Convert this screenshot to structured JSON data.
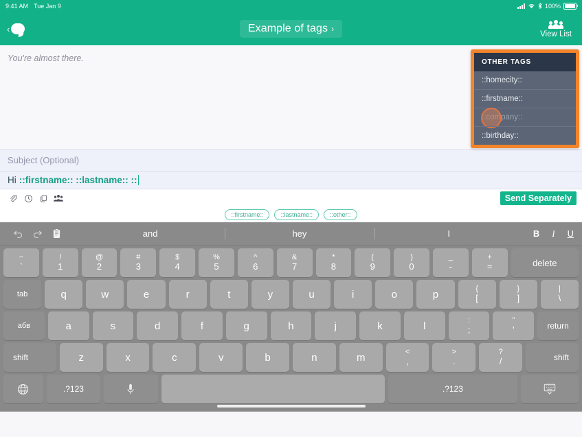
{
  "status_bar": {
    "time": "9:41 AM",
    "date": "Tue Jan 9",
    "battery": "100%",
    "signal_icon": "cellular-signal-icon",
    "wifi_icon": "wifi-icon",
    "battery_icon": "battery-icon"
  },
  "navbar": {
    "back_icon": "back-chevron-icon",
    "messages_icon": "message-bubble-icon",
    "title": "Example of tags",
    "title_chevron": "›",
    "view_list_label": "View List",
    "view_list_icon": "people-group-icon",
    "bg_color": "#12b188"
  },
  "thread": {
    "note": "You're almost there."
  },
  "other_tags_panel": {
    "header": "OTHER TAGS",
    "highlight_color": "#f4842a",
    "items": [
      {
        "label": "::homecity::",
        "dimmed": false,
        "tapped": false
      },
      {
        "label": "::firstname::",
        "dimmed": false,
        "tapped": false
      },
      {
        "label": "::company::",
        "dimmed": true,
        "tapped": true
      },
      {
        "label": "::birthday::",
        "dimmed": false,
        "tapped": false
      }
    ]
  },
  "compose": {
    "subject_placeholder": "Subject (Optional)",
    "message_prefix": "Hi",
    "message_tags": "::firstname:: ::lastname:: ::",
    "icons": [
      {
        "name": "attachment-icon"
      },
      {
        "name": "schedule-clock-icon"
      },
      {
        "name": "templates-icon"
      },
      {
        "name": "group-contacts-icon"
      }
    ],
    "send_separately_label": "Send Separately",
    "send_color": "#13b58c",
    "chips": [
      "::firstname::",
      "::lastname::",
      "::other::"
    ]
  },
  "keyboard": {
    "toolbar": {
      "undo_icon": "undo-icon",
      "redo_icon": "redo-icon",
      "paste_icon": "paste-clipboard-icon",
      "suggestions": [
        "and",
        "hey",
        "I"
      ],
      "bold_label": "B",
      "italic_label": "I",
      "underline_label": "U"
    },
    "row_numbers": [
      {
        "up": "~",
        "lo": "`"
      },
      {
        "up": "!",
        "lo": "1"
      },
      {
        "up": "@",
        "lo": "2"
      },
      {
        "up": "#",
        "lo": "3"
      },
      {
        "up": "$",
        "lo": "4"
      },
      {
        "up": "%",
        "lo": "5"
      },
      {
        "up": "^",
        "lo": "6"
      },
      {
        "up": "&",
        "lo": "7"
      },
      {
        "up": "*",
        "lo": "8"
      },
      {
        "up": "(",
        "lo": "9"
      },
      {
        "up": ")",
        "lo": "0"
      },
      {
        "up": "_",
        "lo": "-"
      },
      {
        "up": "+",
        "lo": "="
      }
    ],
    "delete_label": "delete",
    "tab_label": "tab",
    "row_top": [
      "q",
      "w",
      "e",
      "r",
      "t",
      "y",
      "u",
      "i",
      "o",
      "p"
    ],
    "row_top_extra": [
      {
        "up": "{",
        "lo": "["
      },
      {
        "up": "}",
        "lo": "]"
      },
      {
        "up": "|",
        "lo": "\\"
      }
    ],
    "caps_label": "абв",
    "row_home": [
      "a",
      "s",
      "d",
      "f",
      "g",
      "h",
      "j",
      "k",
      "l"
    ],
    "row_home_extra": [
      {
        "up": ":",
        "lo": ";"
      },
      {
        "up": "\"",
        "lo": "'"
      }
    ],
    "return_label": "return",
    "shift_left_label": "shift",
    "shift_right_label": "shift",
    "row_bottom": [
      "z",
      "x",
      "c",
      "v",
      "b",
      "n",
      "m"
    ],
    "row_bottom_extra": [
      {
        "up": "<",
        "lo": ","
      },
      {
        "up": ">",
        "lo": "."
      },
      {
        "up": "?",
        "lo": "/"
      }
    ],
    "globe_icon": "globe-language-icon",
    "numeric_label_left": ".?123",
    "mic_icon": "microphone-icon",
    "space_label": "",
    "numeric_label_right": ".?123",
    "dismiss_icon": "hide-keyboard-icon"
  }
}
